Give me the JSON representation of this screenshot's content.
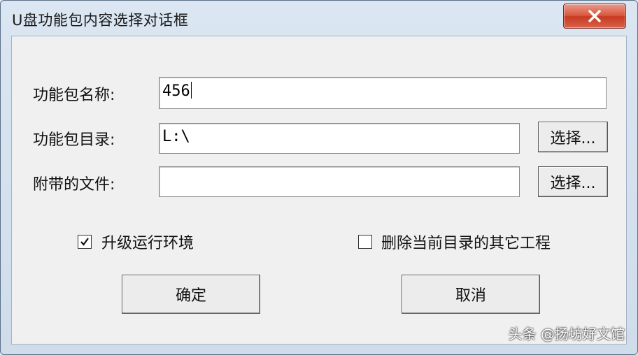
{
  "window": {
    "title": "U盘功能包内容选择对话框"
  },
  "form": {
    "name_label": "功能包名称:",
    "name_value": "456",
    "dir_label": "功能包目录:",
    "dir_value": "L:\\",
    "dir_browse": "选择...",
    "files_label": "附带的文件:",
    "files_value": "",
    "files_browse": "选择..."
  },
  "options": {
    "upgrade_label": "升级运行环境",
    "upgrade_checked": true,
    "delete_label": "删除当前目录的其它工程",
    "delete_checked": false
  },
  "buttons": {
    "ok": "确定",
    "cancel": "取消"
  },
  "watermark": "头条 @扬坊好文馆"
}
